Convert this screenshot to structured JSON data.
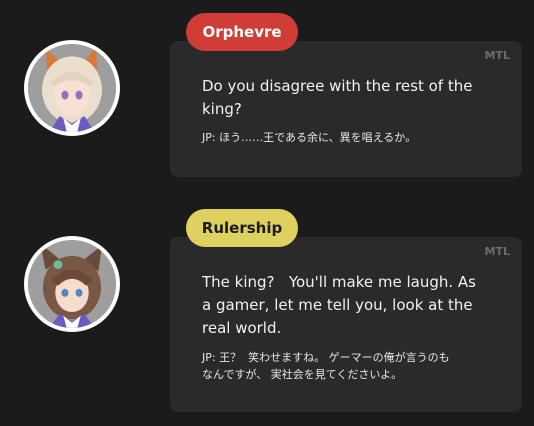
{
  "messages": [
    {
      "speaker": "Orphevre",
      "tag_color": "#d03c36",
      "tag_text_color": "#ffffff",
      "badge": "MTL",
      "english": "Do you disagree with the rest of the\nking?",
      "japanese": "JP: ほう……王である余に、異を唱えるか。",
      "avatar_icon": "orphevre-avatar-icon"
    },
    {
      "speaker": "Rulership",
      "tag_color": "#dfd160",
      "tag_text_color": "#1b1b1b",
      "badge": "MTL",
      "english": "The king?   You'll make me laugh. As\na gamer, let me tell you, look at the\nreal world.",
      "japanese": "JP: 王？  笑わせますね。 ゲーマーの俺が言うのも\nなんですが、 実社会を見てくださいよ。",
      "avatar_icon": "rulership-avatar-icon"
    }
  ]
}
